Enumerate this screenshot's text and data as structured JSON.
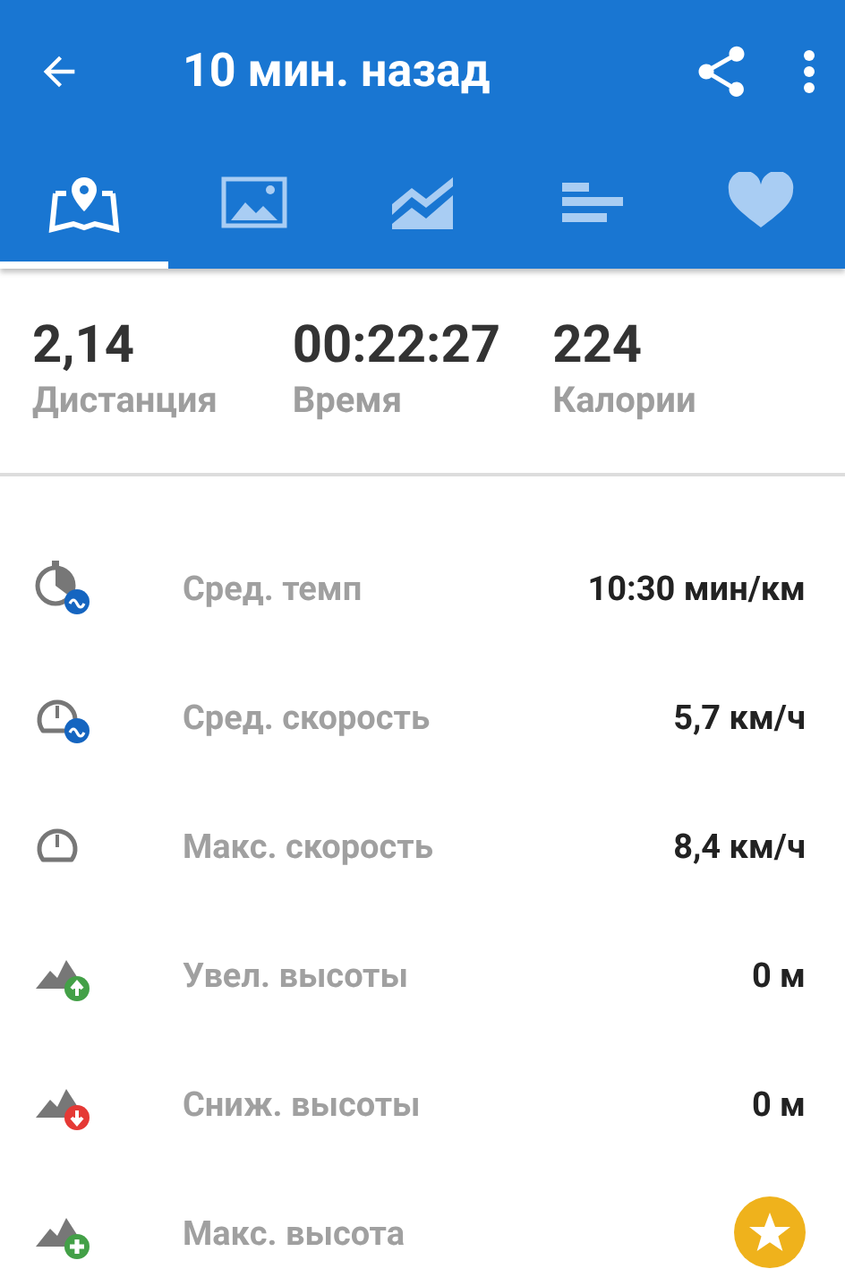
{
  "app_bar": {
    "title": "10 мин. назад"
  },
  "tabs": [
    {
      "kind": "map",
      "selected": true
    },
    {
      "kind": "photos",
      "selected": false
    },
    {
      "kind": "chart",
      "selected": false
    },
    {
      "kind": "splits",
      "selected": false
    },
    {
      "kind": "heart",
      "selected": false
    }
  ],
  "summary": [
    {
      "value": "2,14",
      "label": "Дистанция"
    },
    {
      "value": "00:22:27",
      "label": "Время"
    },
    {
      "value": "224",
      "label": "Калории"
    }
  ],
  "rows": [
    {
      "label": "Сред. темп",
      "kind": "text",
      "value": "10:30 мин/км"
    },
    {
      "label": "Сред. скорость",
      "kind": "text",
      "value": "5,7 км/ч"
    },
    {
      "label": "Макс. скорость",
      "kind": "text",
      "value": "8,4 км/ч"
    },
    {
      "label": "Увел. высоты",
      "kind": "text",
      "value": "0 м"
    },
    {
      "label": "Сниж. высоты",
      "kind": "text",
      "value": "0 м"
    },
    {
      "label": "Макс. высота",
      "kind": "premium"
    }
  ]
}
